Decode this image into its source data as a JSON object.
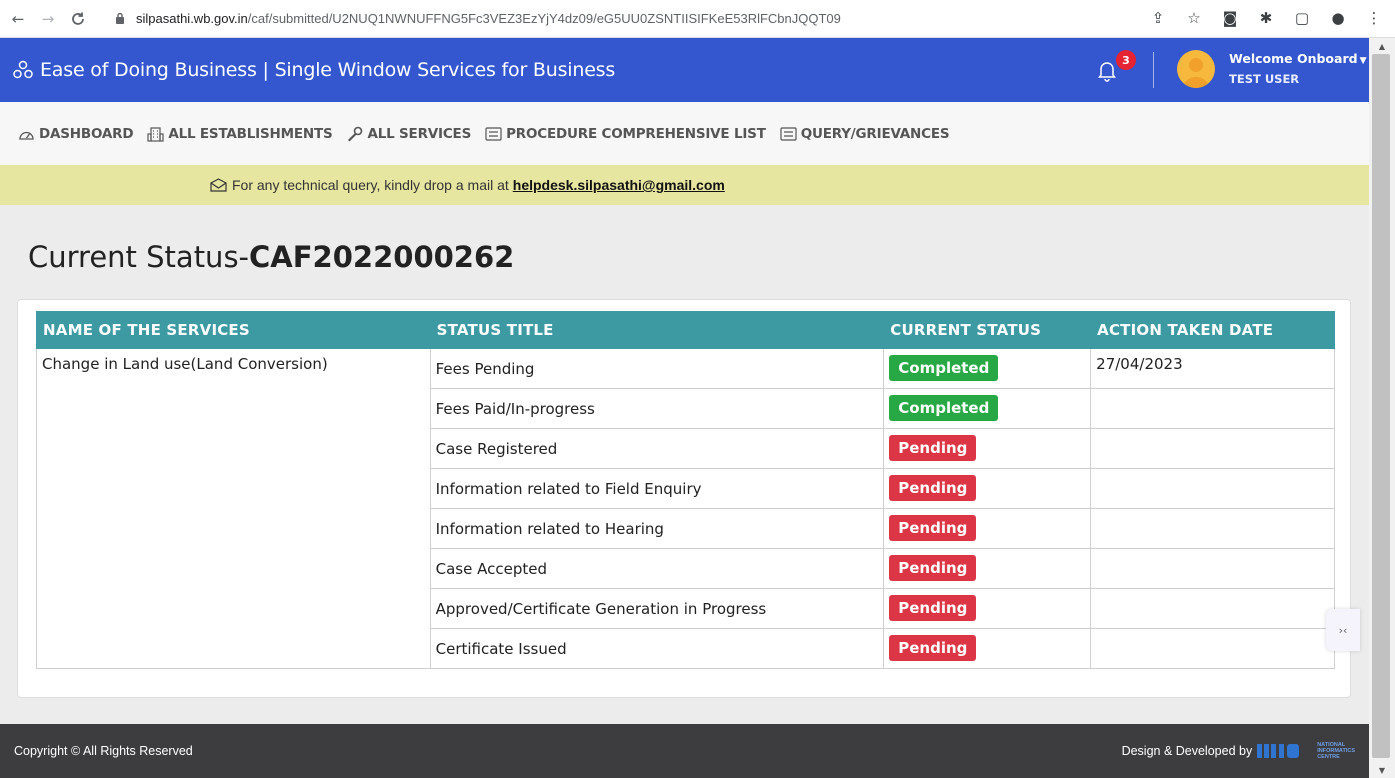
{
  "browser": {
    "url_host": "silpasathi.wb.gov.in",
    "url_path": "/caf/submitted/U2NUQ1NWNUFFNG5Fc3VEZ3EzYjY4dz09/eG5UU0ZSNTIISIFKeE53RlFCbnJQQT09"
  },
  "header": {
    "title": "Ease of Doing Business | Single Window Services for Business",
    "notification_count": "3",
    "welcome": "Welcome Onboard",
    "username": "TEST USER"
  },
  "menu": {
    "items": [
      {
        "label": "DASHBOARD",
        "icon": "dashboard-icon"
      },
      {
        "label": "ALL ESTABLISHMENTS",
        "icon": "building-icon"
      },
      {
        "label": "ALL SERVICES",
        "icon": "wrench-icon"
      },
      {
        "label": "PROCEDURE COMPREHENSIVE LIST",
        "icon": "list-icon"
      },
      {
        "label": "QUERY/GRIEVANCES",
        "icon": "list-icon"
      }
    ]
  },
  "notice": {
    "text": "For any technical query, kindly drop a mail at",
    "email": "helpdesk.silpasathi@gmail.com"
  },
  "page": {
    "title_prefix": "Current Status-",
    "caf_id": "CAF2022000262"
  },
  "table": {
    "headers": [
      "NAME OF THE SERVICES",
      "STATUS TITLE",
      "CURRENT STATUS",
      "ACTION TAKEN DATE"
    ],
    "service_name": "Change in Land use(Land Conversion)",
    "rows": [
      {
        "title": "Fees Pending",
        "status": "Completed",
        "date": "27/04/2023"
      },
      {
        "title": "Fees Paid/In-progress",
        "status": "Completed",
        "date": ""
      },
      {
        "title": "Case Registered",
        "status": "Pending",
        "date": ""
      },
      {
        "title": "Information related to Field Enquiry",
        "status": "Pending",
        "date": ""
      },
      {
        "title": "Information related to Hearing",
        "status": "Pending",
        "date": ""
      },
      {
        "title": "Case Accepted",
        "status": "Pending",
        "date": ""
      },
      {
        "title": "Approved/Certificate Generation in Progress",
        "status": "Pending",
        "date": ""
      },
      {
        "title": "Certificate Issued",
        "status": "Pending",
        "date": ""
      }
    ]
  },
  "footer": {
    "copyright": "Copyright © All Rights Reserved",
    "developed_by": "Design & Developed by",
    "nic_line1": "NATIONAL",
    "nic_line2": "INFORMATICS",
    "nic_line3": "CENTRE"
  },
  "colors": {
    "header_bg": "#3457d0",
    "table_header_bg": "#3d9aa3",
    "completed": "#28a745",
    "pending": "#dc3545",
    "notice_bg": "#e7e6a1",
    "footer_bg": "#3d3d40"
  }
}
